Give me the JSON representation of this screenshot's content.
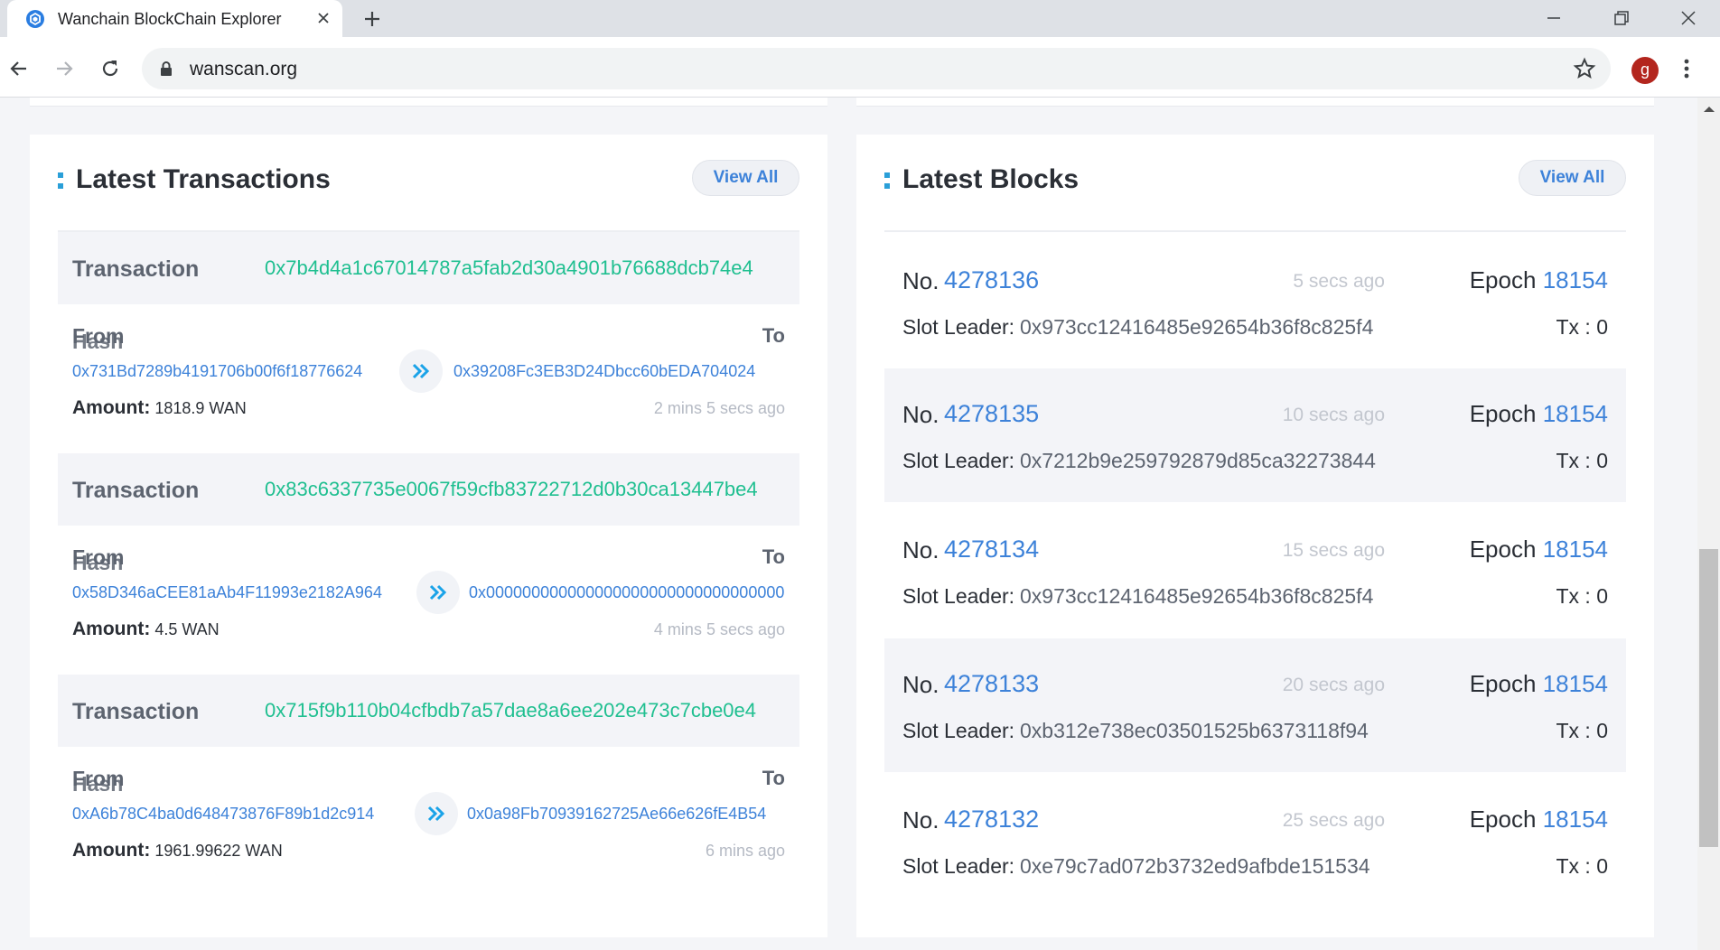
{
  "browser": {
    "tab_title": "Wanchain BlockChain Explorer",
    "url": "wanscan.org",
    "profile_initial": "g"
  },
  "transactions": {
    "title": "Latest Transactions",
    "view_all": "View All",
    "tx_label": "Transaction",
    "from_label": "From",
    "hash_label": "Hash",
    "to_label": "To",
    "amount_label": "Amount:",
    "items": [
      {
        "hash": "0x7b4d4a1c67014787a5fab2d30a4901b76688dcb74e4",
        "from": "0x731Bd7289b4191706b00f6f18776624",
        "to": "0x39208Fc3EB3D24Dbcc60bEDA704024",
        "amount": "1818.9 WAN",
        "time": "2 mins 5 secs ago"
      },
      {
        "hash": "0x83c6337735e0067f59cfb83722712d0b30ca13447be4",
        "from": "0x58D346aCEE81aAb4F11993e2182A964",
        "to": "0x000000000000000000000000000000000",
        "amount": "4.5 WAN",
        "time": "4 mins 5 secs ago"
      },
      {
        "hash": "0x715f9b110b04cfbdb7a57dae8a6ee202e473c7cbe0e4",
        "from": "0xA6b78C4ba0d648473876F89b1d2c914",
        "to": "0x0a98Fb70939162725Ae66e626fE4B54",
        "amount": "1961.99622 WAN",
        "time": "6 mins ago"
      }
    ]
  },
  "blocks": {
    "title": "Latest Blocks",
    "view_all": "View All",
    "no_label": "No.",
    "epoch_label": "Epoch",
    "slot_label": "Slot Leader:",
    "tx_prefix": "Tx : ",
    "items": [
      {
        "number": "4278136",
        "time": "5 secs ago",
        "epoch": "18154",
        "slot_leader": "0x973cc12416485e92654b36f8c825f4",
        "tx": "Tx : 0"
      },
      {
        "number": "4278135",
        "time": "10 secs ago",
        "epoch": "18154",
        "slot_leader": "0x7212b9e259792879d85ca32273844",
        "tx": "Tx : 0"
      },
      {
        "number": "4278134",
        "time": "15 secs ago",
        "epoch": "18154",
        "slot_leader": "0x973cc12416485e92654b36f8c825f4",
        "tx": "Tx : 0"
      },
      {
        "number": "4278133",
        "time": "20 secs ago",
        "epoch": "18154",
        "slot_leader": "0xb312e738ec03501525b6373118f94",
        "tx": "Tx : 0"
      },
      {
        "number": "4278132",
        "time": "25 secs ago",
        "epoch": "18154",
        "slot_leader": "0xe79c7ad072b3732ed9afbde151534",
        "tx": "Tx : 0"
      }
    ]
  },
  "colors": {
    "accent_blue": "#3d82d9",
    "hash_green": "#1fbf90",
    "arrow_cyan": "#1aa3e8"
  }
}
